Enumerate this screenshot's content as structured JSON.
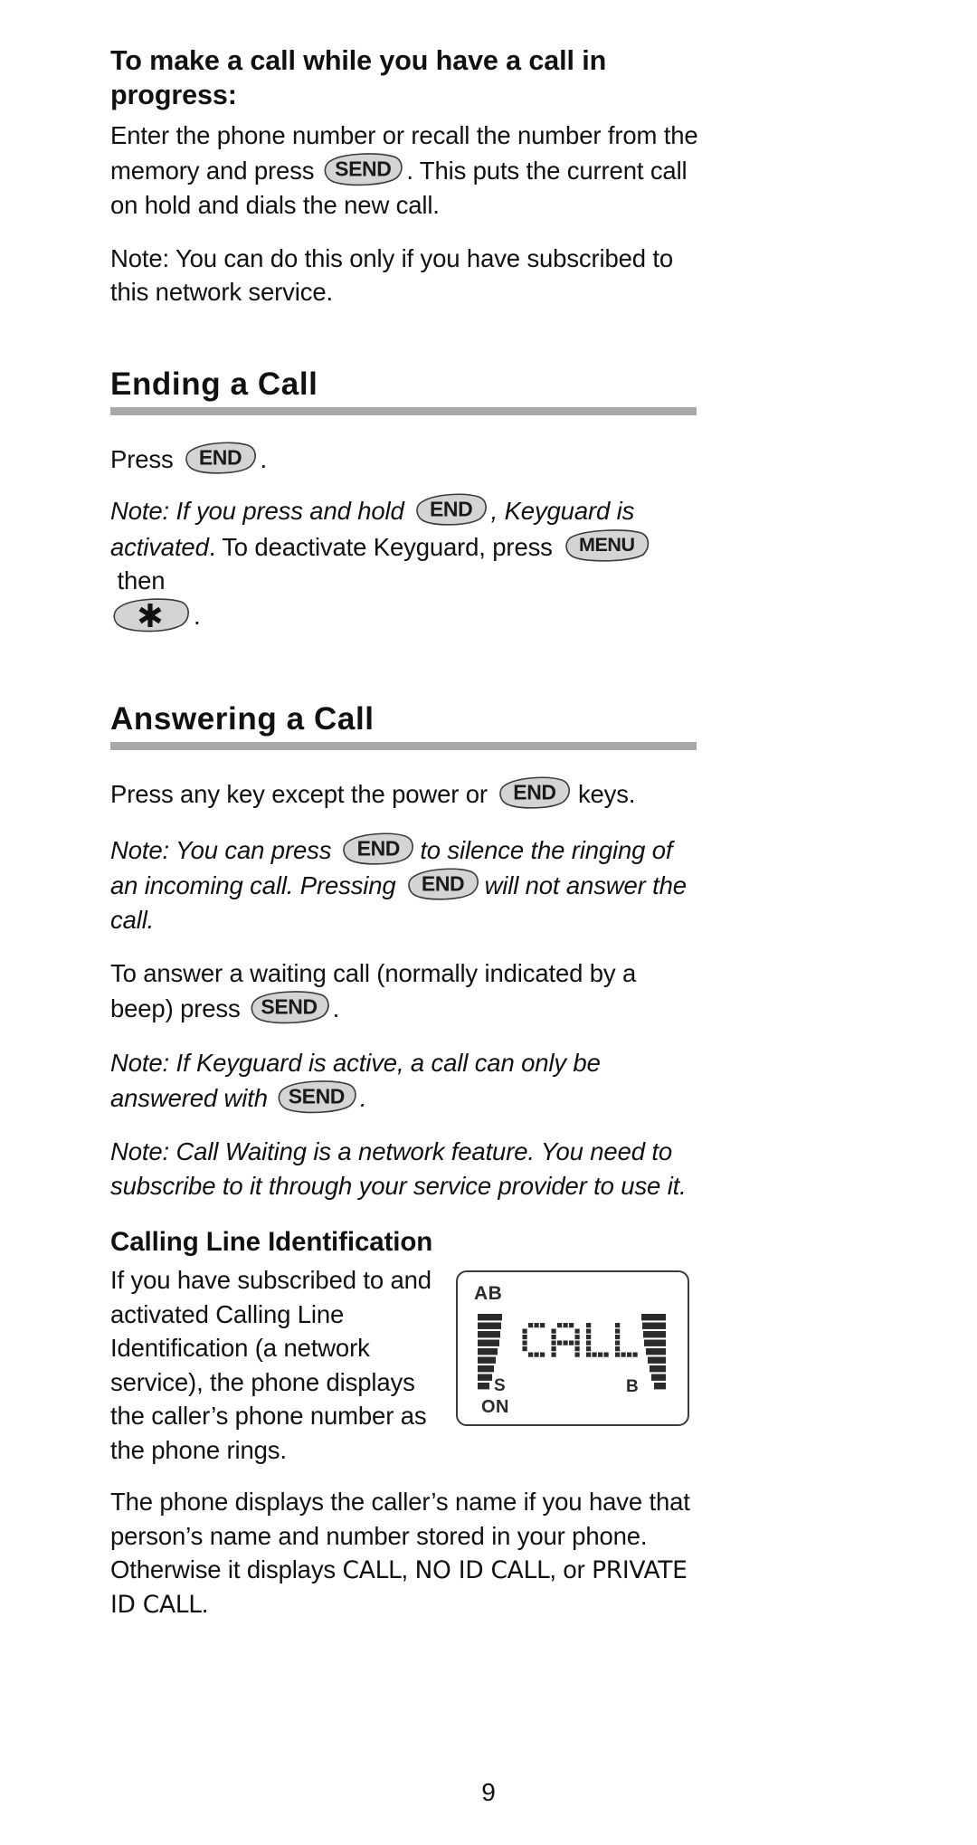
{
  "page": {
    "number": "9"
  },
  "sections": {
    "make_call": {
      "heading": "To make a call while you have a call in progress:",
      "para1_a": "Enter the phone number or recall the number from the memory and press",
      "para1_b": ". This puts the current call on hold and dials the new call.",
      "para2": "Note: You can do this only if you have subscribed to this network service."
    },
    "ending_call": {
      "heading": "Ending a Call",
      "press_label": "Press",
      "press_after": ".",
      "note_a": "Note: If you press and hold",
      "note_b": ", Keyguard is activated",
      "note_c": ". To deactivate Keyguard, press",
      "note_d": "then",
      "note_e": "."
    },
    "answering_call": {
      "heading": "Answering a Call",
      "para1_a": "Press any key except the power or",
      "para1_b": "keys.",
      "note1_a": "Note: You can press",
      "note1_b": "to silence the ringing of an incoming call. Pressing",
      "note1_c": "will not answer the call.",
      "para2_a": "To answer a waiting call (normally indicated by a beep) press",
      "para2_b": ".",
      "note2_a": "Note: If Keyguard is active, a call can only be answered with",
      "note2_b": ".",
      "note3": "Note: Call Waiting is a network feature. You need to subscribe to it through your service provider to use it."
    },
    "calling_line_id": {
      "heading": "Calling Line Identification",
      "left_para": "If you have subscribed to and activated Calling Line Identification (a network service), the phone displays the caller’s phone number as the phone rings.",
      "final_a": "The phone displays the caller’s name if you have that person’s name and number stored in your phone. Otherwise it displays",
      "final_d1": "CALL",
      "final_sep1": ",",
      "final_d2": "NO ID  CALL",
      "final_sep2": ",",
      "final_or": "or",
      "final_d3": "PRIVATE ID CALL",
      "final_end": "."
    }
  },
  "keys": {
    "send": "SEND",
    "end": "END",
    "menu": "MENU",
    "asterisk": "✳"
  },
  "lcd": {
    "indicator_ab": "AB",
    "indicator_s": "S",
    "indicator_on": "ON",
    "indicator_b": "B",
    "display_text": "CALL"
  },
  "colors": {
    "key_fill": "#d4d4d4",
    "key_stroke": "#3a3a3a",
    "rule": "#a8a8a8",
    "text": "#111111",
    "lcd_segment": "#2b2b2b"
  }
}
